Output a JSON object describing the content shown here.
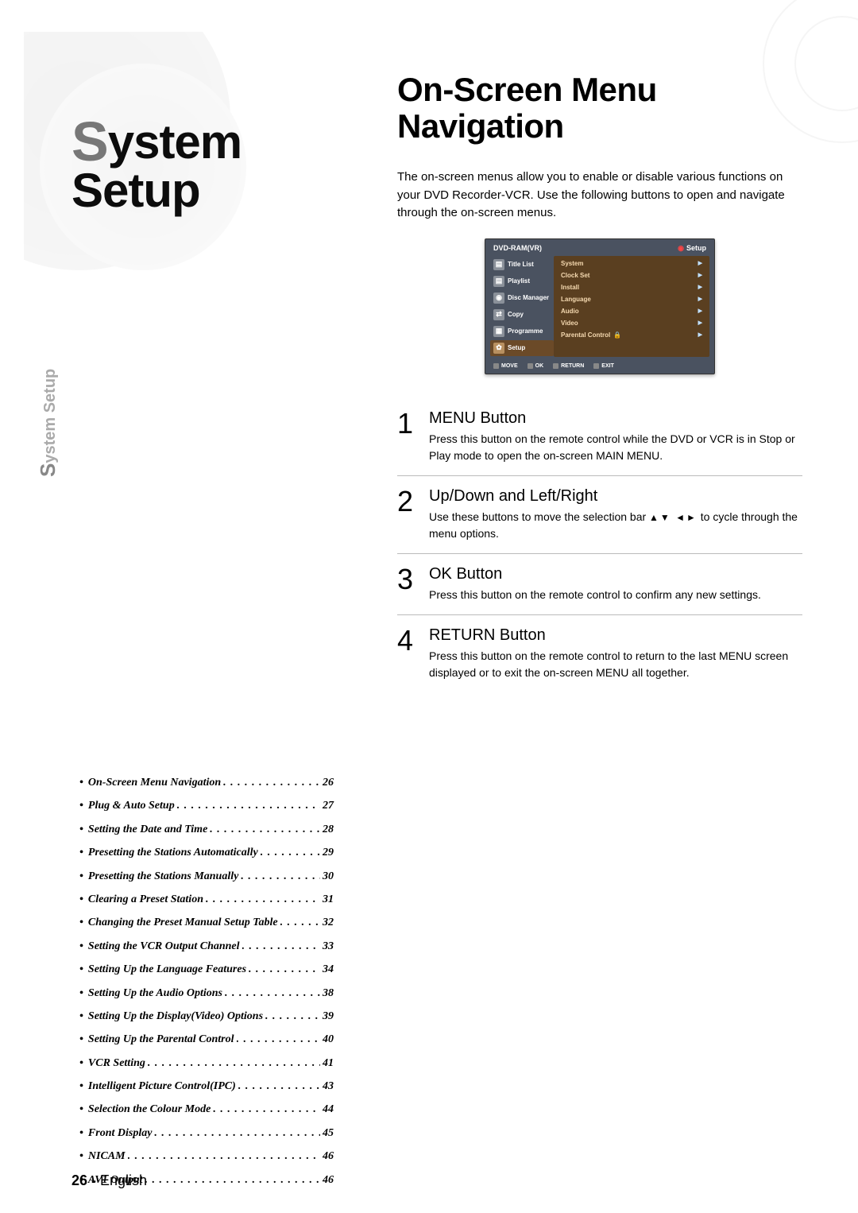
{
  "left": {
    "title_first": "S",
    "title_rest": "ystem Setup",
    "side_label_first": "S",
    "side_label_rest": "ystem Setup"
  },
  "toc": [
    {
      "label": "On-Screen Menu Navigation",
      "page": "26"
    },
    {
      "label": "Plug & Auto Setup",
      "page": "27"
    },
    {
      "label": "Setting the Date and Time",
      "page": "28"
    },
    {
      "label": "Presetting the Stations Automatically",
      "page": "29"
    },
    {
      "label": "Presetting the Stations Manually",
      "page": "30"
    },
    {
      "label": "Clearing a Preset Station",
      "page": "31"
    },
    {
      "label": "Changing the Preset Manual Setup Table",
      "page": "32"
    },
    {
      "label": "Setting the VCR Output Channel",
      "page": "33"
    },
    {
      "label": "Setting Up the Language Features",
      "page": "34"
    },
    {
      "label": "Setting Up the Audio Options",
      "page": "38"
    },
    {
      "label": "Setting Up the Display(Video) Options",
      "page": "39"
    },
    {
      "label": "Setting Up the Parental Control",
      "page": "40"
    },
    {
      "label": "VCR Setting",
      "page": "41"
    },
    {
      "label": "Intelligent Picture Control(IPC)",
      "page": "43"
    },
    {
      "label": "Selection the Colour Mode",
      "page": "44"
    },
    {
      "label": "Front Display",
      "page": "45"
    },
    {
      "label": "NICAM",
      "page": "46"
    },
    {
      "label": "AV1 Output",
      "page": "46"
    }
  ],
  "footer": {
    "page": "26",
    "sep": " - ",
    "lang": "English"
  },
  "right": {
    "title": "On-Screen Menu Navigation",
    "intro": "The on-screen menus allow you to enable or disable various functions on your DVD Recorder-VCR. Use the following buttons to open and navigate through the on-screen menus."
  },
  "osd": {
    "header_left": "DVD-RAM(VR)",
    "header_right": "Setup",
    "left_items": [
      {
        "icon": "▤",
        "label": "Title List"
      },
      {
        "icon": "▤",
        "label": "Playlist"
      },
      {
        "icon": "◉",
        "label": "Disc Manager"
      },
      {
        "icon": "⇄",
        "label": "Copy"
      },
      {
        "icon": "▦",
        "label": "Programme"
      },
      {
        "icon": "✿",
        "label": "Setup",
        "selected": true
      }
    ],
    "right_items": [
      {
        "label": "System"
      },
      {
        "label": "Clock Set"
      },
      {
        "label": "Install"
      },
      {
        "label": "Language"
      },
      {
        "label": "Audio"
      },
      {
        "label": "Video"
      },
      {
        "label": "Parental Control",
        "lock": true
      }
    ],
    "footer": {
      "move": "MOVE",
      "ok": "OK",
      "return": "RETURN",
      "exit": "EXIT"
    }
  },
  "steps": [
    {
      "num": "1",
      "title": "MENU Button",
      "desc": "Press this button on the remote control while the DVD or VCR is in Stop or Play mode to open the on-screen MAIN MENU."
    },
    {
      "num": "2",
      "title": "Up/Down and Left/Right",
      "desc_pre": "Use these buttons to move the selection bar ",
      "symbols": "▲▼ ◄►",
      "desc_post": " to cycle through the menu options."
    },
    {
      "num": "3",
      "title": "OK Button",
      "desc": "Press this button on the remote control to confirm any new settings."
    },
    {
      "num": "4",
      "title": "RETURN Button",
      "desc": "Press this button on the remote control to return to the last MENU screen displayed or to exit the on-screen MENU all together."
    }
  ]
}
